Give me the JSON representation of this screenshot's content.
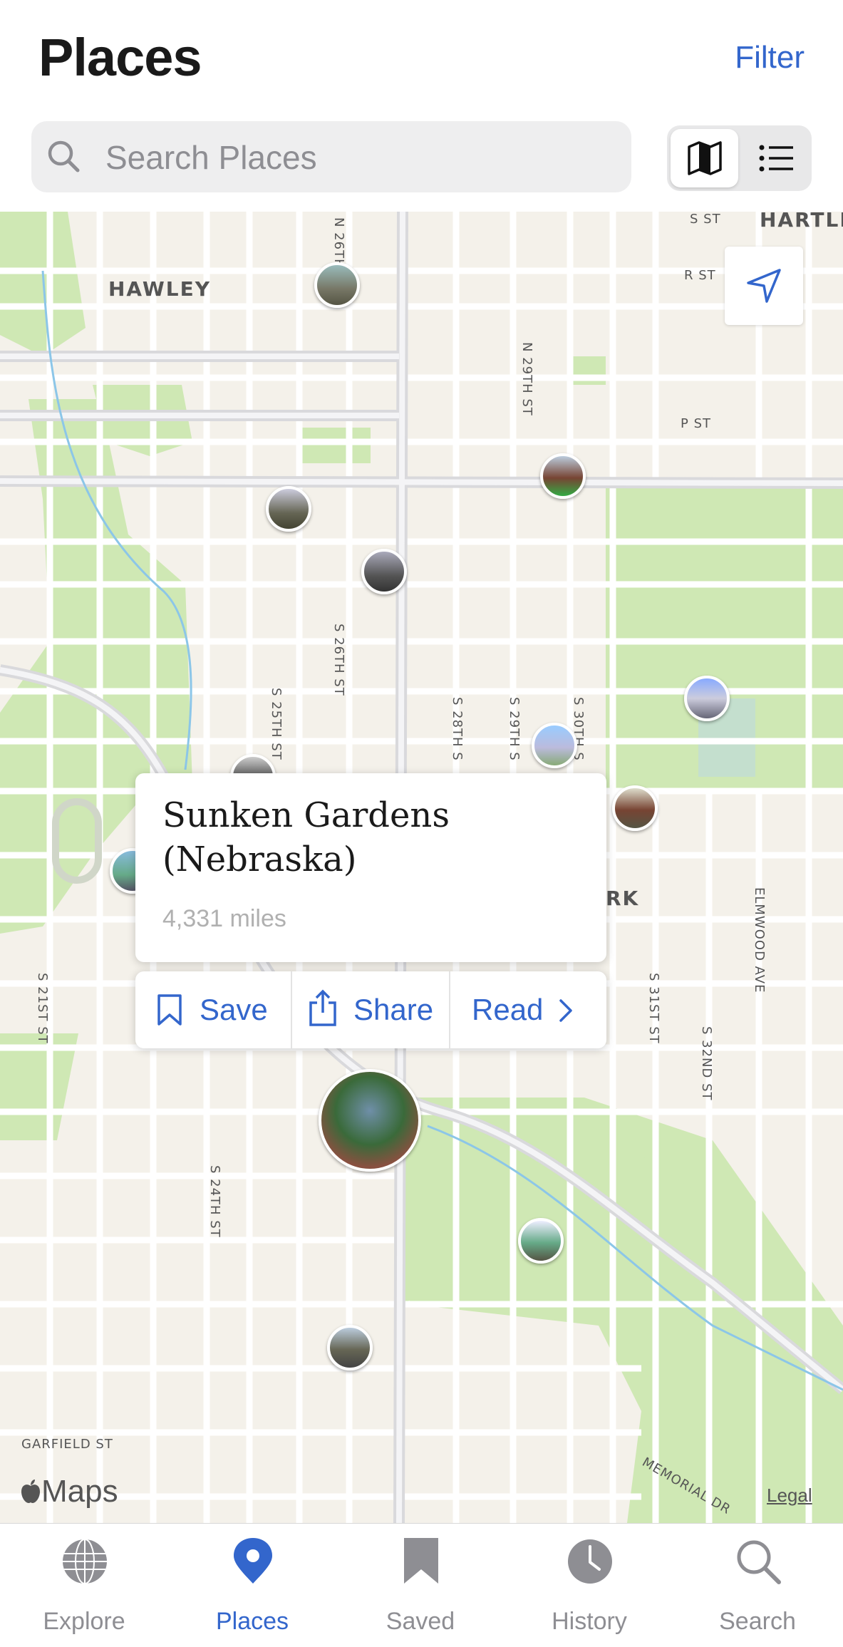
{
  "header": {
    "title": "Places",
    "filter_label": "Filter"
  },
  "search": {
    "placeholder": "Search Places"
  },
  "view_toggle": {
    "selected": "map"
  },
  "map": {
    "districts": [
      "HAWLEY",
      "HARTLE"
    ],
    "street_labels": [
      "S ST",
      "R ST",
      "P ST",
      "N 26TH",
      "N 29TH ST",
      "S 25TH ST",
      "S 26TH ST",
      "S 28TH S",
      "S 29TH S",
      "S 30TH S",
      "S 21ST ST",
      "S 24TH ST",
      "S 31ST ST",
      "S 32ND ST",
      "ELMWOOD AVE",
      "GARFIELD ST",
      "MEMORIAL DR"
    ],
    "partial_label": "RK",
    "attribution": "Maps",
    "legal_label": "Legal"
  },
  "callout": {
    "title": "Sunken Gardens (Nebraska)",
    "distance": "4,331 miles",
    "actions": [
      {
        "label": "Save",
        "icon": "bookmark-icon"
      },
      {
        "label": "Share",
        "icon": "share-icon"
      },
      {
        "label": "Read",
        "icon": "chevron-right-icon"
      }
    ]
  },
  "tabbar": {
    "tabs": [
      {
        "label": "Explore",
        "icon": "globe-icon"
      },
      {
        "label": "Places",
        "icon": "map-pin-icon",
        "active": true
      },
      {
        "label": "Saved",
        "icon": "bookmark-icon"
      },
      {
        "label": "History",
        "icon": "clock-icon"
      },
      {
        "label": "Search",
        "icon": "search-icon"
      }
    ]
  },
  "colors": {
    "accent": "#3366cc",
    "inactive": "#8e8e93",
    "park": "#cfe8b4",
    "road": "#ffffff"
  }
}
